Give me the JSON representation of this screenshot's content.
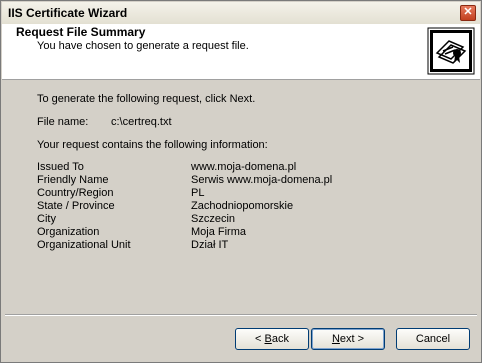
{
  "window": {
    "title": "IIS Certificate Wizard",
    "close_glyph": "✕"
  },
  "header": {
    "title": "Request File Summary",
    "subtitle": "You have chosen to generate a request file.",
    "icon": "certificate-icon"
  },
  "body": {
    "instruction": "To generate the following request, click Next.",
    "file_label": "File name:",
    "file_value": "c:\\certreq.txt",
    "info_intro": "Your request contains the following information:",
    "info": [
      {
        "key": "Issued To",
        "value": "www.moja-domena.pl"
      },
      {
        "key": "Friendly Name",
        "value": "Serwis www.moja-domena.pl"
      },
      {
        "key": "Country/Region",
        "value": "PL"
      },
      {
        "key": "State / Province",
        "value": "Zachodniopomorskie"
      },
      {
        "key": "City",
        "value": "Szczecin"
      },
      {
        "key": "Organization",
        "value": "Moja Firma"
      },
      {
        "key": "Organizational Unit",
        "value": "Dział IT"
      }
    ]
  },
  "buttons": {
    "back": {
      "mnemonic": "B",
      "rest": "ack",
      "prefix": "< "
    },
    "next": {
      "mnemonic": "N",
      "rest": "ext",
      "suffix": " >"
    },
    "cancel": "Cancel"
  }
}
